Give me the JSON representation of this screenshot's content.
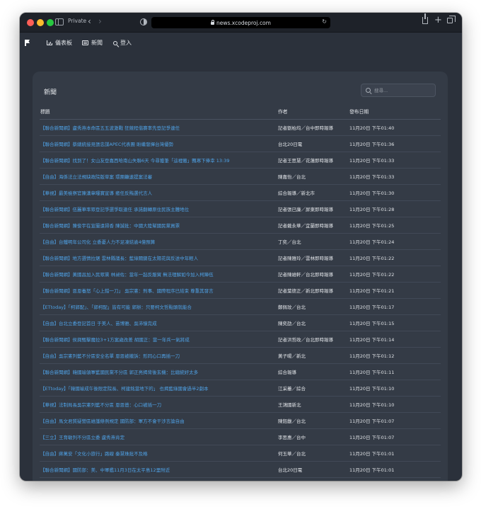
{
  "browser": {
    "private_label": "Private",
    "url": "news.xcodeproj.com"
  },
  "navbar": {
    "items": [
      {
        "label": "儀表板",
        "icon": "chart-icon"
      },
      {
        "label": "新聞",
        "icon": "newspaper-icon"
      },
      {
        "label": "登入",
        "icon": "key-icon"
      }
    ]
  },
  "page": {
    "title": "新聞",
    "search": {
      "placeholder": "搜尋...",
      "value": ""
    }
  },
  "table": {
    "headers": [
      "標題",
      "作者",
      "發布日期"
    ],
    "rows": [
      {
        "title": "【聯合新聞網】盧秀燕本命區五五波激戰 狂競程偕賽率先登記爭連任",
        "author": "記者劉柏均／台中即時報導",
        "date": "11月20日 下午01:40"
      },
      {
        "title": "【聯合新聞網】蔡總統接見張忠謀APEC代表團 盼繼發揮台灣優勢",
        "author": "台北20日電",
        "date": "11月20日 下午01:36"
      },
      {
        "title": "【聯合新聞網】找到了！女山友登嘉西哈南山失聯6天 今尋獲筆「這裡搬」飄寒下俸幸 13:39",
        "author": "記者王思慧／花蓮即時報導",
        "date": "11月20日 下午01:33"
      },
      {
        "title": "【自由】海係法立法規缺政院版草案 環團籲速提案法審",
        "author": "陳嘉怡／台北",
        "date": "11月20日 下午01:33"
      },
      {
        "title": "【華視】最美檢察官陳漢章曝寶宣導 癒任反賄選代言人",
        "author": "綜合報導／新北市",
        "date": "11月20日 下午01:30"
      },
      {
        "title": "【聯合新聞網】伍麗華率眾登記爭選爭取連任 承諾翻轉原住民族主體地位",
        "author": "記者張已廉／屏東即時報導",
        "date": "11月20日 下午01:28"
      },
      {
        "title": "【聯合新聞網】陳俊宇在宣蘭遠掃香 陳誠批：中國大陸幫國民黨買票",
        "author": "記者戴永華／宜蘭即時報導",
        "date": "11月20日 下午01:25"
      },
      {
        "title": "【自由】台鐵明年公司化 立委憂人力不足凍結逾4億預算",
        "author": "丁奕／台北",
        "date": "11月20日 下午01:24"
      },
      {
        "title": "【聯合新聞網】地方選情拉鋸 雲林縣議長：藍綠關鍵在太陽花與反送中年輕人",
        "author": "記者陳雅玲／雲林即時報導",
        "date": "11月20日 下午01:22"
      },
      {
        "title": "【聯合新聞網】黃國昌加入民眾黨 林昶佐：當年一起反服貿 無法理解如今加入柯陣伍",
        "author": "記者陳維軒／台北即時報導",
        "date": "11月20日 下午01:22"
      },
      {
        "title": "【聯合新聞網】恩恩養怒「心上錯一刀」 吳宗憲：刑事、國際程序已結束 尊重其發言",
        "author": "記者葉德正／新北即時報導",
        "date": "11月20日 下午01:21"
      },
      {
        "title": "【ETtoday】「柯郭配」、「郭柯配」皆有可能 郭辦：只要柯文哲點頭就能合",
        "author": "鄭佩玟／台北",
        "date": "11月20日 下午01:17"
      },
      {
        "title": "【自由】台北立委登記首日 于美人、苗博雅、吳沛憶完成",
        "author": "陳奕劭／台北",
        "date": "11月20日 下午01:15"
      },
      {
        "title": "【聯合新聞網】侯興甄擊魔拉3+1方案歲改差 胡國正：當一年兵一氣將成",
        "author": "記者洪哲政／台北即時報導",
        "date": "11月20日 下午01:14"
      },
      {
        "title": "【自由】吳宗憲列藍不分區安全名單 恩恩被撤訴：形同心口再插一刀",
        "author": "黃子暘／新北",
        "date": "11月20日 下午01:12"
      },
      {
        "title": "【聯合新聞網】韓國瑜領軍藍國民黨不分區 郭正亮揭背後玄機：比總統好太多",
        "author": "綜合報導",
        "date": "11月20日 下午01:11"
      },
      {
        "title": "【ETtoday】「韓國瑜成午後限定院長、柯建銘當地下的」 也揭藍綠國會過半2劇本",
        "author": "江采蓁／綜合",
        "date": "11月20日 下午01:10"
      },
      {
        "title": "【華視】法制局長吳宗憲列藍不分區 恩恩爸：心口被插一刀",
        "author": "王鴻國新北",
        "date": "11月20日 下午01:10"
      },
      {
        "title": "【自由】馬文君質疑營區維護條例規定 國防部：軍方不會干涉言論自由",
        "author": "陳鈺馥／台北",
        "date": "11月20日 下午01:07"
      },
      {
        "title": "【三立】王育敏列不分區立委 盧秀燕肯定",
        "author": "李思惠／台中",
        "date": "11月20日 下午01:07"
      },
      {
        "title": "【自由】蔣萬安「文化小旅行」路線 秦慧珠批不及格",
        "author": "何玉華／台北",
        "date": "11月20日 下午01:01"
      },
      {
        "title": "【聯合新聞網】國防部：美、中軍艦11月3日在太平島12里附近",
        "author": "台北20日電",
        "date": "11月20日 下午01:01"
      }
    ]
  }
}
